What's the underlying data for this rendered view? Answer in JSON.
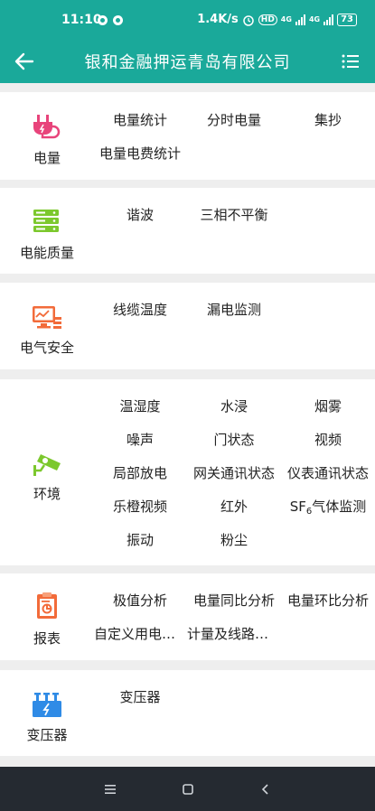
{
  "status": {
    "time": "11:10",
    "speed": "1.4K/s",
    "hd": "HD",
    "net1": "4G",
    "net2": "4G",
    "battery": "73"
  },
  "header": {
    "title": "银和金融押运青岛有限公司"
  },
  "colors": {
    "primary": "#1aa99a",
    "plug": "#e8447b",
    "server": "#7cc82d",
    "monitor": "#f26b3a",
    "camera": "#7cc82d",
    "report": "#f26b3a",
    "transformer": "#2f8be6"
  },
  "sections": {
    "energy": {
      "label": "电量",
      "icon": "plug-icon",
      "items": [
        "电量统计",
        "分时电量",
        "集抄",
        "电量电费统计"
      ]
    },
    "quality": {
      "label": "电能质量",
      "icon": "server-icon",
      "items": [
        "谐波",
        "三相不平衡"
      ]
    },
    "safety": {
      "label": "电气安全",
      "icon": "monitor-chart-icon",
      "items": [
        "线缆温度",
        "漏电监测"
      ]
    },
    "environment": {
      "label": "环境",
      "icon": "camera-icon",
      "items": [
        "温湿度",
        "水浸",
        "烟雾",
        "噪声",
        "门状态",
        "视频",
        "局部放电",
        "网关通讯状态",
        "仪表通讯状态",
        "乐橙视频",
        "红外",
        "SF",
        "6",
        "气体监测",
        "振动",
        "粉尘"
      ]
    },
    "report": {
      "label": "报表",
      "icon": "clipboard-icon",
      "items": [
        "极值分析",
        "电量同比分析",
        "电量环比分析",
        "自定义用电…",
        "计量及线路…"
      ]
    },
    "transformer": {
      "label": "变压器",
      "icon": "transformer-icon",
      "items": [
        "变压器"
      ]
    }
  }
}
